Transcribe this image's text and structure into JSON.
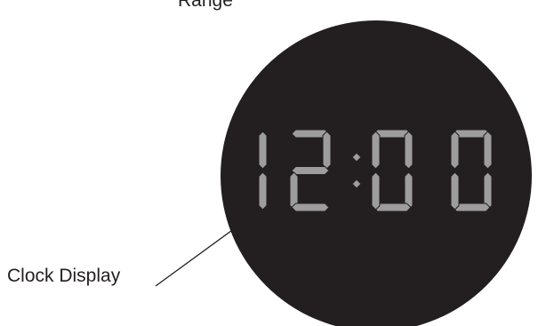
{
  "labels": {
    "top": "Range",
    "callout": "Clock Display"
  },
  "display": {
    "time": "12:00",
    "segment_color": "#9d9d9d",
    "face_color": "#231f20"
  }
}
